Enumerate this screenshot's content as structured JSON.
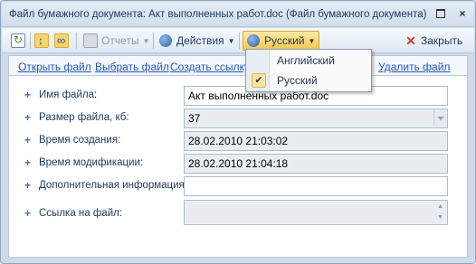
{
  "window": {
    "title": "Файл бумажного документа: Акт выполненных работ.doc (Файл бумажного документа)",
    "restore_icon": "restore-icon",
    "close_icon": "close-icon",
    "close_glyph": "×"
  },
  "toolbar": {
    "reports_label": "Отчеты",
    "actions_label": "Действия",
    "language_label": "Русский",
    "close_label": "Закрыть",
    "caret": "▼"
  },
  "links": {
    "open_file": "Открыть файл",
    "select_file": "Выбрать файл",
    "create_link": "Создать ссылку",
    "delete_file": "Удалить файл"
  },
  "form": {
    "file_name": {
      "label": "Имя файла:",
      "value": "Акт выполненных работ.doc"
    },
    "file_size": {
      "label": "Размер файла, кб:",
      "value": "37"
    },
    "created": {
      "label": "Время создания:",
      "value": "28.02.2010 21:03:02"
    },
    "modified": {
      "label": "Время модификации:",
      "value": "28.02.2010 21:04:18"
    },
    "extra_info": {
      "label": "Дополнительная информация:",
      "value": ""
    },
    "file_link": {
      "label": "Ссылка на файл:",
      "value": ""
    },
    "plus": "+"
  },
  "language_menu": {
    "items": [
      {
        "label": "Английский",
        "checked": false
      },
      {
        "label": "Русский",
        "checked": true
      }
    ],
    "check_glyph": "✔"
  },
  "colors": {
    "accent": "#f6c94f",
    "link": "#1e5ab4",
    "close": "#d83a2a"
  }
}
